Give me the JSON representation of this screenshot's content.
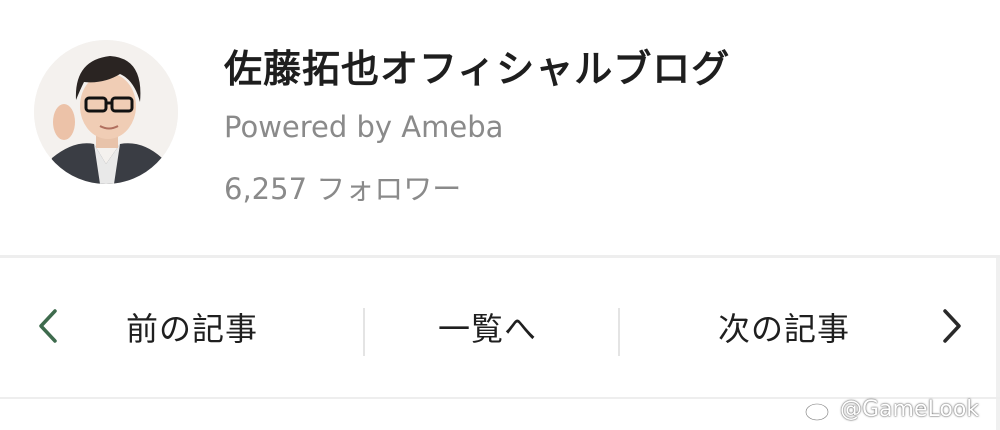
{
  "profile": {
    "blog_title": "佐藤拓也オフィシャルブログ",
    "powered_by": "Powered by Ameba",
    "followers": "6,257 フォロワー"
  },
  "navigation": {
    "prev_label": "前の記事",
    "list_label": "一覧へ",
    "next_label": "次の記事",
    "prev_icon": "chevron-left-icon",
    "next_icon": "chevron-right-icon"
  },
  "watermark": {
    "text": "@GameLook",
    "icon": "weibo-icon"
  },
  "colors": {
    "chevron": "#3e6b4d",
    "title_text": "#1e1e1e",
    "secondary_text": "#8a8a8a",
    "divider": "#eeeeee"
  }
}
